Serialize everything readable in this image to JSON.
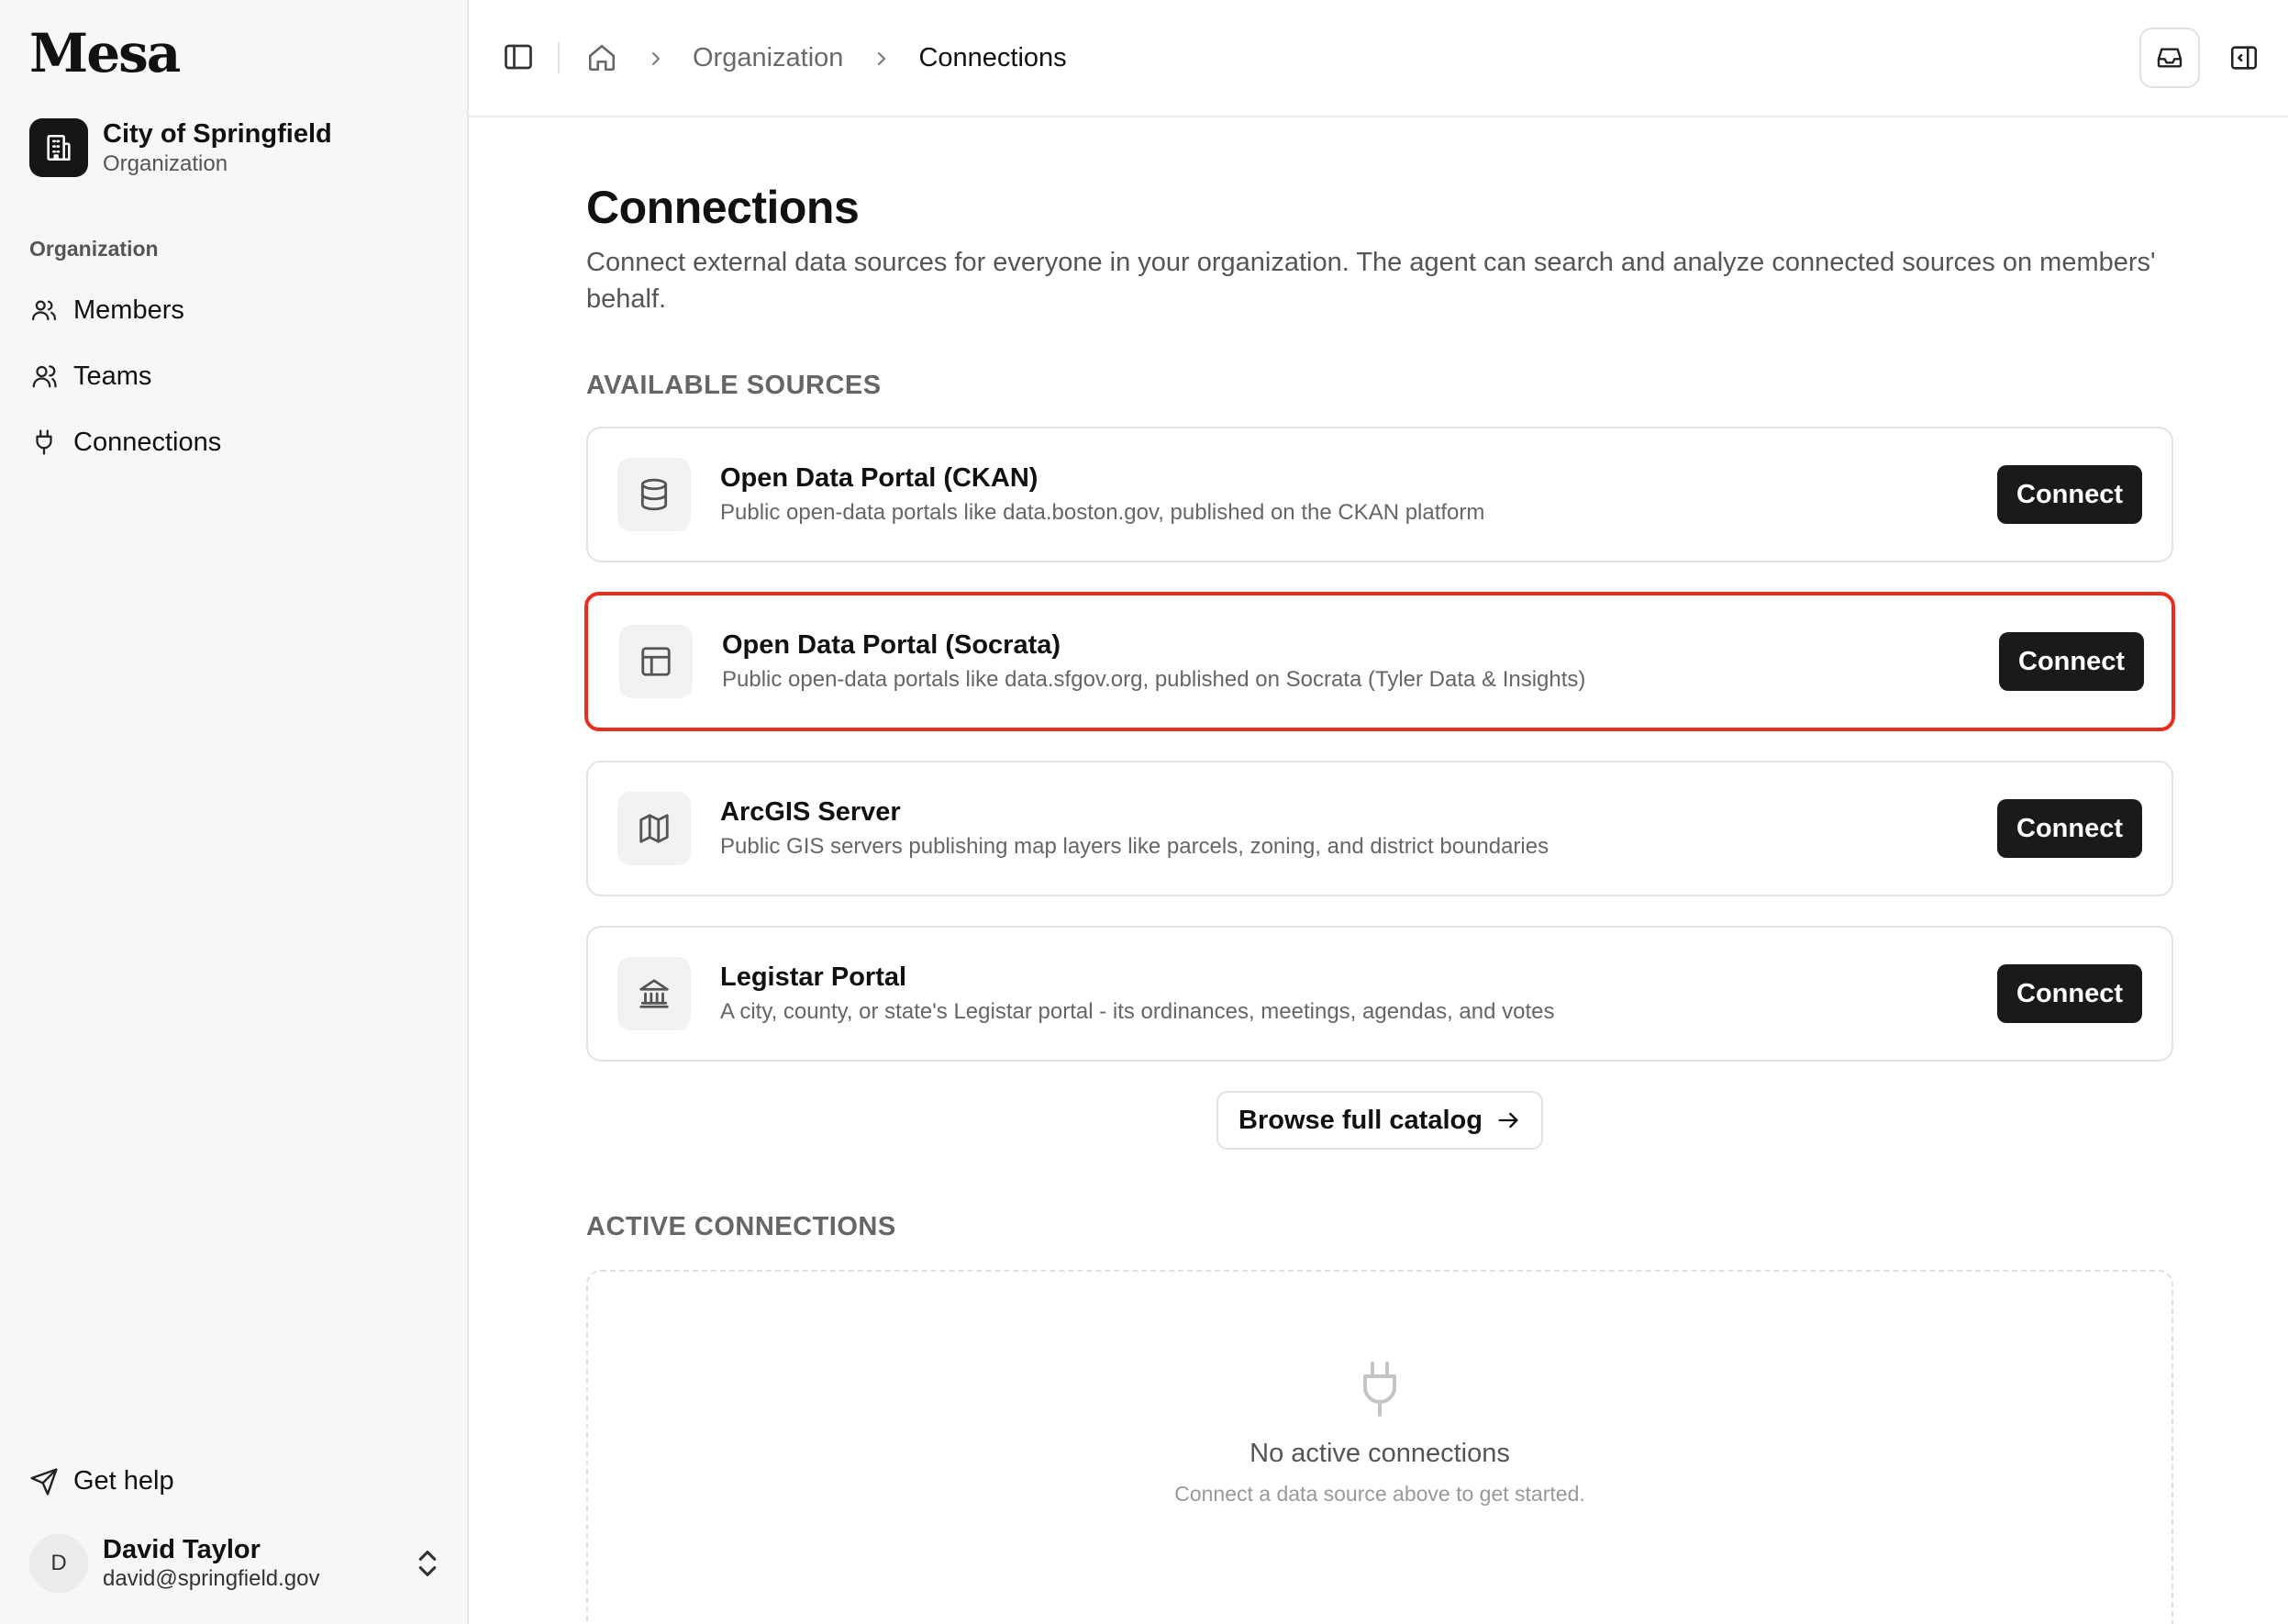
{
  "brand": "Mesa",
  "org": {
    "name": "City of Springfield",
    "type": "Organization"
  },
  "sidebar": {
    "heading": "Organization",
    "items": [
      {
        "label": "Members",
        "icon": "users-icon"
      },
      {
        "label": "Teams",
        "icon": "user-pair-icon"
      },
      {
        "label": "Connections",
        "icon": "plug-icon"
      }
    ],
    "help_label": "Get help"
  },
  "user": {
    "initial": "D",
    "name": "David Taylor",
    "email": "david@springfield.gov"
  },
  "breadcrumb": {
    "items": [
      "Organization",
      "Connections"
    ]
  },
  "page": {
    "title": "Connections",
    "description": "Connect external data sources for everyone in your organization. The agent can search and analyze connected sources on members' behalf."
  },
  "available_sources": {
    "label": "AVAILABLE SOURCES",
    "connect_label": "Connect",
    "items": [
      {
        "title": "Open Data Portal (CKAN)",
        "description": "Public open-data portals like data.boston.gov, published on the CKAN platform",
        "icon": "database-icon"
      },
      {
        "title": "Open Data Portal (Socrata)",
        "description": "Public open-data portals like data.sfgov.org, published on Socrata (Tyler Data & Insights)",
        "icon": "table-icon",
        "highlight_color": "#ea2d1f"
      },
      {
        "title": "ArcGIS Server",
        "description": "Public GIS servers publishing map layers like parcels, zoning, and district boundaries",
        "icon": "map-icon"
      },
      {
        "title": "Legistar Portal",
        "description": "A city, county, or state's Legistar portal - its ordinances, meetings, agendas, and votes",
        "icon": "landmark-icon"
      }
    ]
  },
  "browse_label": "Browse full catalog",
  "active_connections": {
    "label": "ACTIVE CONNECTIONS",
    "empty_title": "No active connections",
    "empty_subtitle": "Connect a data source above to get started."
  },
  "colors": {
    "highlight": "#ea2d1f",
    "button": "#1a1a1a",
    "sidebar_bg": "#f7f7f7"
  }
}
